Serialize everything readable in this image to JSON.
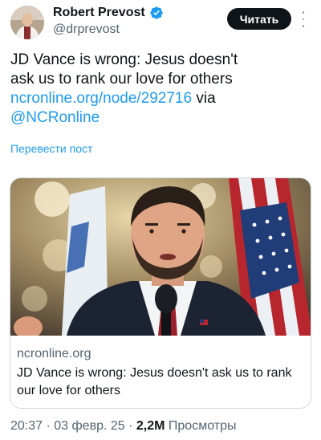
{
  "author": {
    "display_name": "Robert Prevost",
    "handle": "@drprevost",
    "verified_icon": "verified-badge-icon",
    "avatar_icon": "avatar-photo"
  },
  "follow_button": {
    "label": "Читать"
  },
  "more_menu": {
    "icon": "more-vertical-icon"
  },
  "tweet": {
    "text_line1": "JD Vance is wrong: Jesus doesn't",
    "text_line2": "ask us to rank our love for others",
    "link_text": "ncronline.org/node/292716",
    "via_text": " via",
    "mention": "@NCRonline"
  },
  "translate_label": "Перевести пост",
  "link_card": {
    "domain": "ncronline.org",
    "title": "JD Vance is wrong: Jesus doesn't ask us to rank our love for others",
    "image_icon": "article-photo"
  },
  "meta": {
    "time": "20:37",
    "separator": " · ",
    "date": "03 февр. 25",
    "views_count": "2,2M",
    "views_label": " Просмотры"
  },
  "colors": {
    "link": "#1d9bf0",
    "secondary_text": "#536471",
    "primary_text": "#0f1419",
    "button_bg": "#0f1419"
  }
}
